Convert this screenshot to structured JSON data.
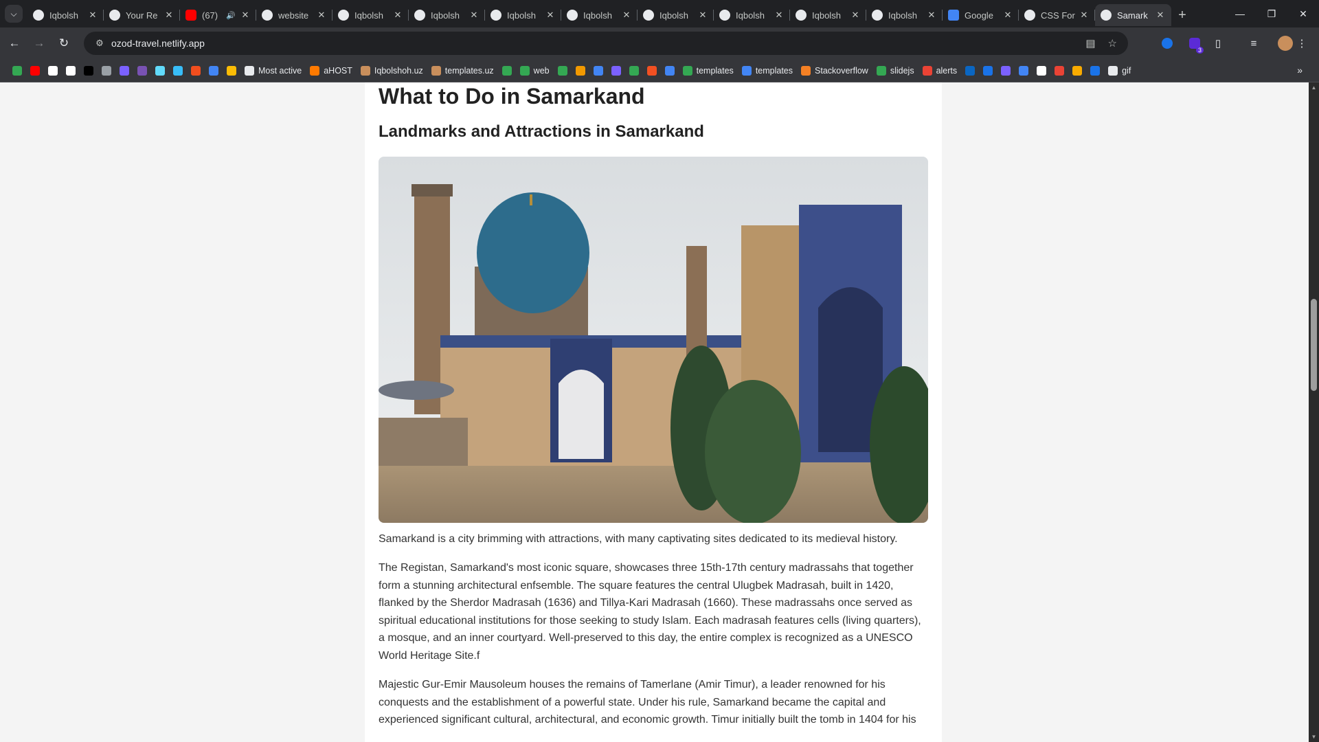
{
  "browser": {
    "tabs": [
      {
        "label": "Iqbolsh",
        "icon": "github-icon",
        "active": false
      },
      {
        "label": "Your Re",
        "icon": "github-icon",
        "active": false
      },
      {
        "label": "(67)",
        "icon": "youtube-icon",
        "active": false,
        "audio": true
      },
      {
        "label": "website",
        "icon": "github-icon",
        "active": false
      },
      {
        "label": "Iqbolsh",
        "icon": "github-icon",
        "active": false
      },
      {
        "label": "Iqbolsh",
        "icon": "github-icon",
        "active": false
      },
      {
        "label": "Iqbolsh",
        "icon": "github-icon",
        "active": false
      },
      {
        "label": "Iqbolsh",
        "icon": "github-icon",
        "active": false
      },
      {
        "label": "Iqbolsh",
        "icon": "github-icon",
        "active": false
      },
      {
        "label": "Iqbolsh",
        "icon": "github-icon",
        "active": false
      },
      {
        "label": "Iqbolsh",
        "icon": "github-icon",
        "active": false
      },
      {
        "label": "Iqbolsh",
        "icon": "github-icon",
        "active": false
      },
      {
        "label": "Google",
        "icon": "google-translate-icon",
        "active": false
      },
      {
        "label": "CSS For",
        "icon": "chatgpt-icon",
        "active": false
      },
      {
        "label": "Samark",
        "icon": "site-icon",
        "active": true
      }
    ],
    "url": "ozod-travel.netlify.app",
    "extension_badge": "3",
    "bookmarks": [
      {
        "label": "",
        "icon": "maps-icon",
        "color": "#34a853"
      },
      {
        "label": "",
        "icon": "youtube-icon",
        "color": "#ff0000"
      },
      {
        "label": "",
        "icon": "chatgpt-icon",
        "color": "#ffffff"
      },
      {
        "label": "",
        "icon": "chatgpt-icon",
        "color": "#ffffff"
      },
      {
        "label": "",
        "icon": "circle-icon",
        "color": "#000000"
      },
      {
        "label": "",
        "icon": "code-icon",
        "color": "#9aa0a6"
      },
      {
        "label": "",
        "icon": "infinity-icon",
        "color": "#7b61ff"
      },
      {
        "label": "",
        "icon": "bootstrap-icon",
        "color": "#7952b3"
      },
      {
        "label": "",
        "icon": "react-icon",
        "color": "#61dafb"
      },
      {
        "label": "",
        "icon": "tailwind-icon",
        "color": "#38bdf8"
      },
      {
        "label": "",
        "icon": "figma-icon",
        "color": "#f24e1e"
      },
      {
        "label": "",
        "icon": "triangle-icon",
        "color": "#4285f4"
      },
      {
        "label": "",
        "icon": "grid-icon",
        "color": "#fbbc05"
      },
      {
        "label": "Most active",
        "icon": "page-icon",
        "color": "#e8eaed"
      },
      {
        "label": "aHOST",
        "icon": "link-icon",
        "color": "#ff7a00"
      },
      {
        "label": "Iqbolshoh.uz",
        "icon": "avatar-icon",
        "color": "#c98f5c"
      },
      {
        "label": "templates.uz",
        "icon": "avatar-icon",
        "color": "#c98f5c"
      },
      {
        "label": "",
        "icon": "w-icon",
        "color": "#34a853"
      },
      {
        "label": "web",
        "icon": "w-icon",
        "color": "#34a853"
      },
      {
        "label": "",
        "icon": "glasses-icon",
        "color": "#34a853"
      },
      {
        "label": "",
        "icon": "cone-icon",
        "color": "#f29900"
      },
      {
        "label": "",
        "icon": "flag-icon",
        "color": "#4285f4"
      },
      {
        "label": "",
        "icon": "square-icon",
        "color": "#7b61ff"
      },
      {
        "label": "",
        "icon": "square-icon",
        "color": "#34a853"
      },
      {
        "label": "",
        "icon": "windows-icon",
        "color": "#f25022"
      },
      {
        "label": "",
        "icon": "translate-icon",
        "color": "#4285f4"
      },
      {
        "label": "templates",
        "icon": "leaf-icon",
        "color": "#34a853"
      },
      {
        "label": "templates",
        "icon": "smile-icon",
        "color": "#4285f4"
      },
      {
        "label": "Stackoverflow",
        "icon": "stackoverflow-icon",
        "color": "#f48024"
      },
      {
        "label": "slidejs",
        "icon": "diamond-icon",
        "color": "#34a853"
      },
      {
        "label": "alerts",
        "icon": "alert-icon",
        "color": "#ea4335"
      },
      {
        "label": "",
        "icon": "linkedin-icon",
        "color": "#0a66c2"
      },
      {
        "label": "",
        "icon": "c-icon",
        "color": "#1a73e8"
      },
      {
        "label": "",
        "icon": "b-icon",
        "color": "#7b61ff"
      },
      {
        "label": "",
        "icon": "swirl-icon",
        "color": "#4285f4"
      },
      {
        "label": "",
        "icon": "i-icon",
        "color": "#ffffff"
      },
      {
        "label": "",
        "icon": "record-icon",
        "color": "#ea4335"
      },
      {
        "label": "",
        "icon": "ce-icon",
        "color": "#f9ab00"
      },
      {
        "label": "",
        "icon": "bolt-icon",
        "color": "#1a73e8"
      },
      {
        "label": "gif",
        "icon": "page-icon",
        "color": "#e8eaed"
      }
    ]
  },
  "page": {
    "title": "What to Do in Samarkand",
    "subtitle": "Landmarks and Attractions in Samarkand",
    "paragraphs": [
      "Samarkand is a city brimming with attractions, with many captivating sites dedicated to its medieval history.",
      "The Registan, Samarkand's most iconic square, showcases three 15th-17th century madrassahs that together form a stunning architectural enfsemble. The square features the central Ulugbek Madrasah, built in 1420, flanked by the Sherdor Madrasah (1636) and Tillya-Kari Madrasah (1660). These madrassahs once served as spiritual educational institutions for those seeking to study Islam. Each madrasah features cells (living quarters), a mosque, and an inner courtyard. Well-preserved to this day, the entire complex is recognized as a UNESCO World Heritage Site.f",
      "Majestic Gur-Emir Mausoleum houses the remains of Tamerlane (Amir Timur), a leader renowned for his conquests and the establishment of a powerful state. Under his rule, Samarkand became the capital and experienced significant cultural, architectural, and economic growth. Timur initially built the tomb in 1404 for his"
    ]
  }
}
